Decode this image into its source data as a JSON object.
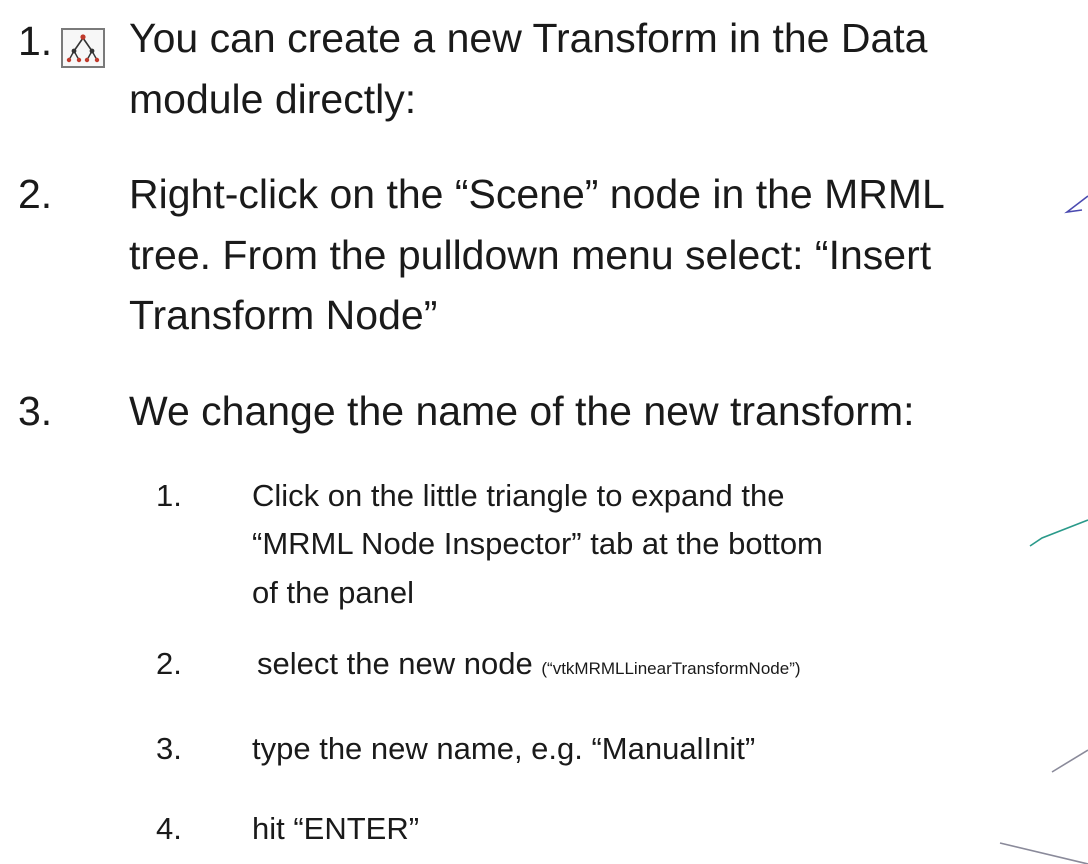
{
  "steps": [
    {
      "num": "1.",
      "lines": [
        "You can create a new Transform in the Data",
        "module directly:"
      ]
    },
    {
      "num": "2.",
      "lines": [
        "Right-click on the “Scene” node in the MRML",
        "tree. From the pulldown menu select: “Insert",
        "Transform Node”"
      ]
    },
    {
      "num": "3.",
      "lines": [
        "We change the name of the new transform:"
      ],
      "substeps": [
        {
          "num": "1.",
          "lines": [
            "Click on the little triangle to expand the",
            "“MRML Node Inspector” tab at the bottom",
            "of the panel"
          ]
        },
        {
          "num": "2.",
          "text": "select the new node",
          "note": "(“vtkMRMLLinearTransformNode”)"
        },
        {
          "num": "3.",
          "text": "type the new name, e.g. “ManualInit”"
        },
        {
          "num": "4.",
          "text": "hit “ENTER”"
        }
      ]
    }
  ],
  "icons": {
    "step1_icon": "transform-hierarchy-icon"
  },
  "colors": {
    "text": "#1a1a1a",
    "arrow_blue": "#4a4ab0",
    "arrow_teal": "#2a9a8a",
    "arrow_gray": "#8a8a9a"
  }
}
